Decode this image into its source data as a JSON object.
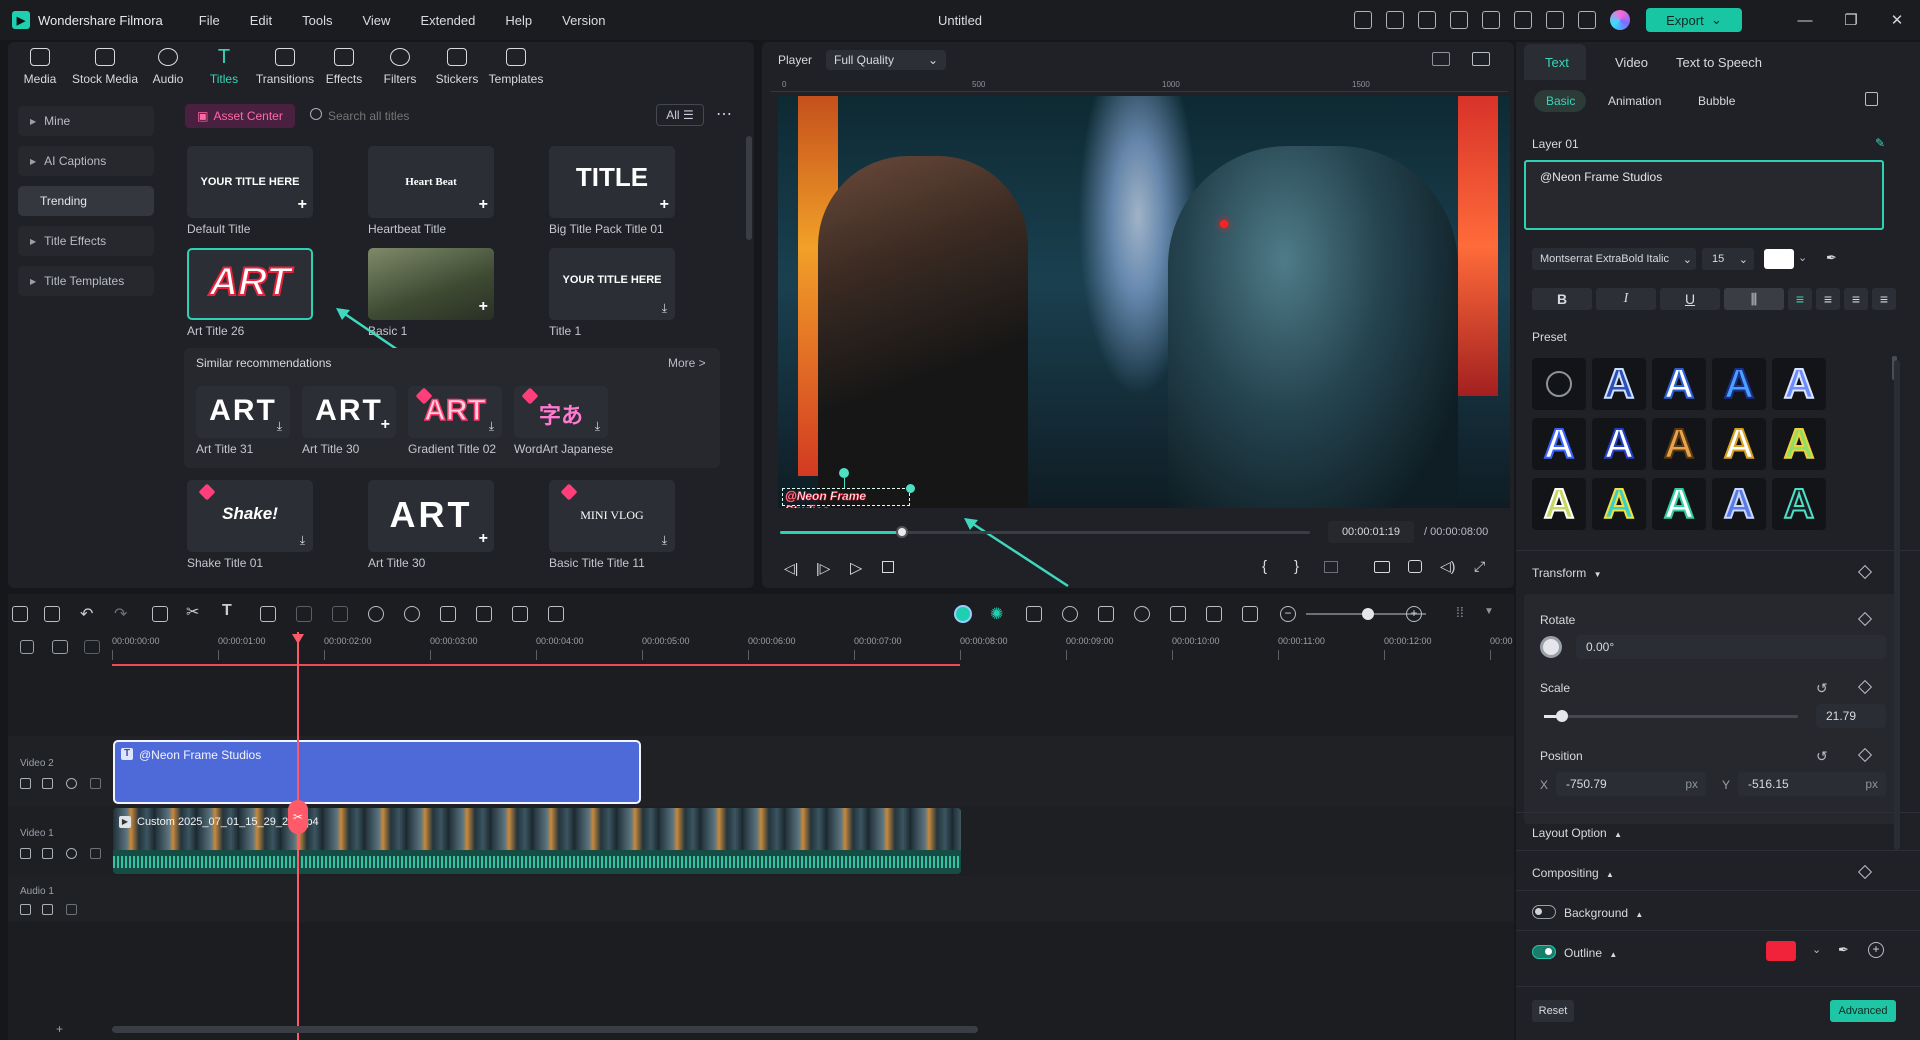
{
  "app": {
    "name": "Wondershare Filmora",
    "window_title": "Untitled",
    "export_label": "Export"
  },
  "menu": [
    "File",
    "Edit",
    "Tools",
    "View",
    "Extended",
    "Help",
    "Version"
  ],
  "toolbar_tabs": [
    {
      "label": "Media",
      "icon": "media-icon"
    },
    {
      "label": "Stock Media",
      "icon": "stock-media-icon"
    },
    {
      "label": "Audio",
      "icon": "audio-icon"
    },
    {
      "label": "Titles",
      "icon": "titles-icon",
      "active": true
    },
    {
      "label": "Transitions",
      "icon": "transitions-icon"
    },
    {
      "label": "Effects",
      "icon": "effects-icon"
    },
    {
      "label": "Filters",
      "icon": "filters-icon"
    },
    {
      "label": "Stickers",
      "icon": "stickers-icon"
    },
    {
      "label": "Templates",
      "icon": "templates-icon"
    }
  ],
  "sidebar": [
    "Mine",
    "AI Captions",
    "Trending",
    "Title Effects",
    "Title Templates"
  ],
  "library": {
    "asset_center": "Asset Center",
    "search_placeholder": "Search all titles",
    "filter": "All",
    "titles": [
      {
        "label": "Default Title",
        "thumb_text": "YOUR TITLE HERE"
      },
      {
        "label": "Heartbeat Title",
        "thumb_text": "Heart Beat"
      },
      {
        "label": "Big Title Pack Title 01",
        "thumb_text": "TITLE"
      },
      {
        "label": "Art Title 26",
        "thumb_text": "ART"
      },
      {
        "label": "Basic 1",
        "thumb_text": ""
      },
      {
        "label": "Title 1",
        "thumb_text": "YOUR TITLE HERE"
      },
      {
        "label": "Shake Title 01",
        "thumb_text": "Shake!"
      },
      {
        "label": "Art Title 30",
        "thumb_text": "ART"
      },
      {
        "label": "Basic Title Title 11",
        "thumb_text": "MINI VLOG"
      }
    ],
    "similar": {
      "heading": "Similar recommendations",
      "more": "More >",
      "items": [
        {
          "label": "Art Title 31",
          "thumb_text": "ART"
        },
        {
          "label": "Art Title 30",
          "thumb_text": "ART"
        },
        {
          "label": "Gradient Title 02",
          "thumb_text": "ART"
        },
        {
          "label": "WordArt Japanese",
          "thumb_text": "字あ"
        }
      ]
    }
  },
  "player": {
    "label": "Player",
    "quality": "Full Quality",
    "overlay_text": "@Neon Frame Studios",
    "ruler": [
      "0",
      "500",
      "1000",
      "1500"
    ],
    "current_time": "00:00:01:19",
    "total_time": "/ 00:00:08:00",
    "progress": 0.23
  },
  "right_panel": {
    "tabs": [
      "Text",
      "Video",
      "Text to Speech"
    ],
    "subtabs": [
      "Basic",
      "Animation",
      "Bubble"
    ],
    "layer": "Layer 01",
    "text_value": "@Neon Frame Studios",
    "font": "Montserrat ExtraBold Italic",
    "font_size": "15",
    "preset_label": "Preset",
    "transform": "Transform",
    "rotate_label": "Rotate",
    "rotate_value": "0.00°",
    "scale_label": "Scale",
    "scale_value": "21.79",
    "position_label": "Position",
    "pos_x_label": "X",
    "pos_x": "-750.79",
    "pos_y_label": "Y",
    "pos_y": "-516.15",
    "unit": "px",
    "layout_option": "Layout Option",
    "compositing": "Compositing",
    "background": "Background",
    "outline": "Outline",
    "outline_color": "#f0233a",
    "reset": "Reset",
    "advanced": "Advanced"
  },
  "timeline": {
    "ruler": [
      "00:00:00:00",
      "00:00:01:00",
      "00:00:02:00",
      "00:00:03:00",
      "00:00:04:00",
      "00:00:05:00",
      "00:00:06:00",
      "00:00:07:00",
      "00:00:08:00",
      "00:00:09:00",
      "00:00:10:00",
      "00:00:11:00",
      "00:00:12:00",
      "00:00"
    ],
    "tracks": [
      "Video 2",
      "Video 1",
      "Audio 1"
    ],
    "title_clip": "@Neon Frame Studios",
    "video_clip": "Custom 2025_07_01_15_29_29.mp4"
  },
  "colors": {
    "accent": "#1fd0b0",
    "title_clip": "#4e6ad8",
    "playhead": "#ff5a6a"
  }
}
